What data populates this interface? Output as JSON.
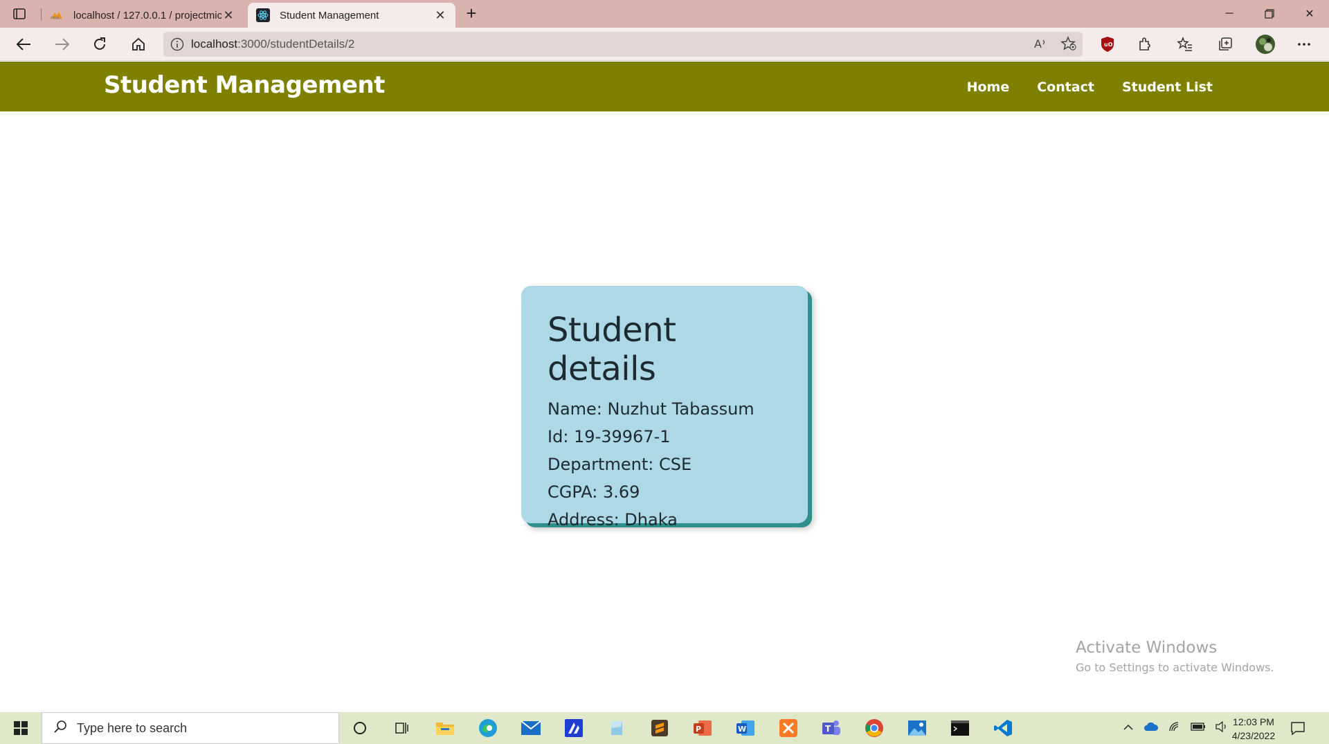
{
  "browser": {
    "tabs": [
      {
        "title": "localhost / 127.0.0.1 / projectmic",
        "favicon": "phpmyadmin-icon",
        "active": false
      },
      {
        "title": "Student Management",
        "favicon": "react-icon",
        "active": true
      }
    ],
    "url_host": "localhost",
    "url_path": ":3000/studentDetails/2"
  },
  "app": {
    "brand": "Student Management",
    "nav": {
      "home": "Home",
      "contact": "Contact",
      "student_list": "Student List"
    },
    "colors": {
      "navbar": "#7f8000",
      "card": "#add8e6",
      "card_shadow": "#2e8f8c"
    }
  },
  "student": {
    "heading": "Student details",
    "name": "Name: Nuzhut Tabassum",
    "id": "Id: 19-39967-1",
    "department": "Department: CSE",
    "cgpa": "CGPA: 3.69",
    "address": "Address: Dhaka"
  },
  "watermark": {
    "line1": "Activate Windows",
    "line2": "Go to Settings to activate Windows."
  },
  "taskbar": {
    "search_placeholder": "Type here to search",
    "time": "12:03 PM",
    "date": "4/23/2022"
  }
}
